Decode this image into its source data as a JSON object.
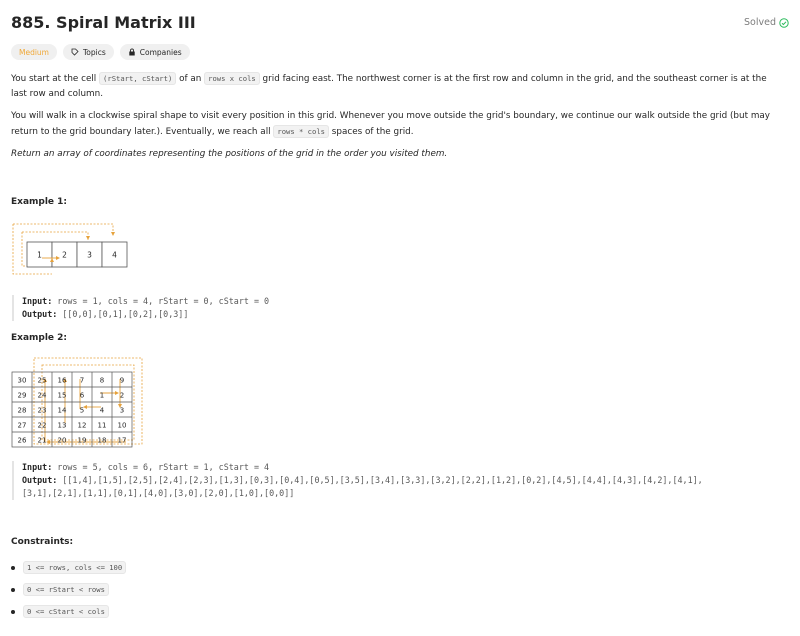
{
  "problem": {
    "title": "885. Spiral Matrix III",
    "status": "Solved",
    "tags": {
      "difficulty": "Medium",
      "topics": "Topics",
      "companies": "Companies"
    }
  },
  "description": {
    "p1": {
      "a": "You start at the cell ",
      "c1": "(rStart, cStart)",
      "b": " of an ",
      "c2": "rows x cols",
      "c": " grid facing east. The northwest corner is at the first row and column in the grid, and the southeast corner is at the last row and column."
    },
    "p2": {
      "a": "You will walk in a clockwise spiral shape to visit every position in this grid. Whenever you move outside the grid's boundary, we continue our walk outside the grid (but may return to the grid boundary later.). Eventually, we reach all ",
      "c1": "rows * cols",
      "b": " spaces of the grid."
    },
    "p3": "Return an array of coordinates representing the positions of the grid in the order you visited them."
  },
  "examples": [
    {
      "heading": "Example 1:",
      "grid": [
        [
          "1",
          "2",
          "3",
          "4"
        ]
      ],
      "input_label": "Input:",
      "input": " rows = 1, cols = 4, rStart = 0, cStart = 0",
      "output_label": "Output:",
      "output": " [[0,0],[0,1],[0,2],[0,3]]"
    },
    {
      "heading": "Example 2:",
      "grid": [
        [
          "30",
          "25",
          "16",
          "7",
          "8",
          "9"
        ],
        [
          "29",
          "24",
          "15",
          "6",
          "1",
          "2"
        ],
        [
          "28",
          "23",
          "14",
          "5",
          "4",
          "3"
        ],
        [
          "27",
          "22",
          "13",
          "12",
          "11",
          "10"
        ],
        [
          "26",
          "21",
          "20",
          "19",
          "18",
          "17"
        ]
      ],
      "input_label": "Input:",
      "input": " rows = 5, cols = 6, rStart = 1, cStart = 4",
      "output_label": "Output:",
      "output": " [[1,4],[1,5],[2,5],[2,4],[2,3],[1,3],[0,3],[0,4],[0,5],[3,5],[3,4],[3,3],[3,2],[2,2],[1,2],[0,2],[4,5],[4,4],[4,3],[4,2],[4,1],\n[3,1],[2,1],[1,1],[0,1],[4,0],[3,0],[2,0],[1,0],[0,0]]"
    }
  ],
  "constraints": {
    "heading": "Constraints:",
    "items": [
      "1 <= rows, cols <= 100",
      "0 <= rStart < rows",
      "0 <= cStart < cols"
    ]
  },
  "colors": {
    "accent_orange": "#f0a93a",
    "path": "#e6a23c",
    "solved_green": "#2cbb5d"
  },
  "icons": {
    "solved": "check-circle-icon",
    "topics": "tag-icon",
    "companies": "lock-icon"
  }
}
